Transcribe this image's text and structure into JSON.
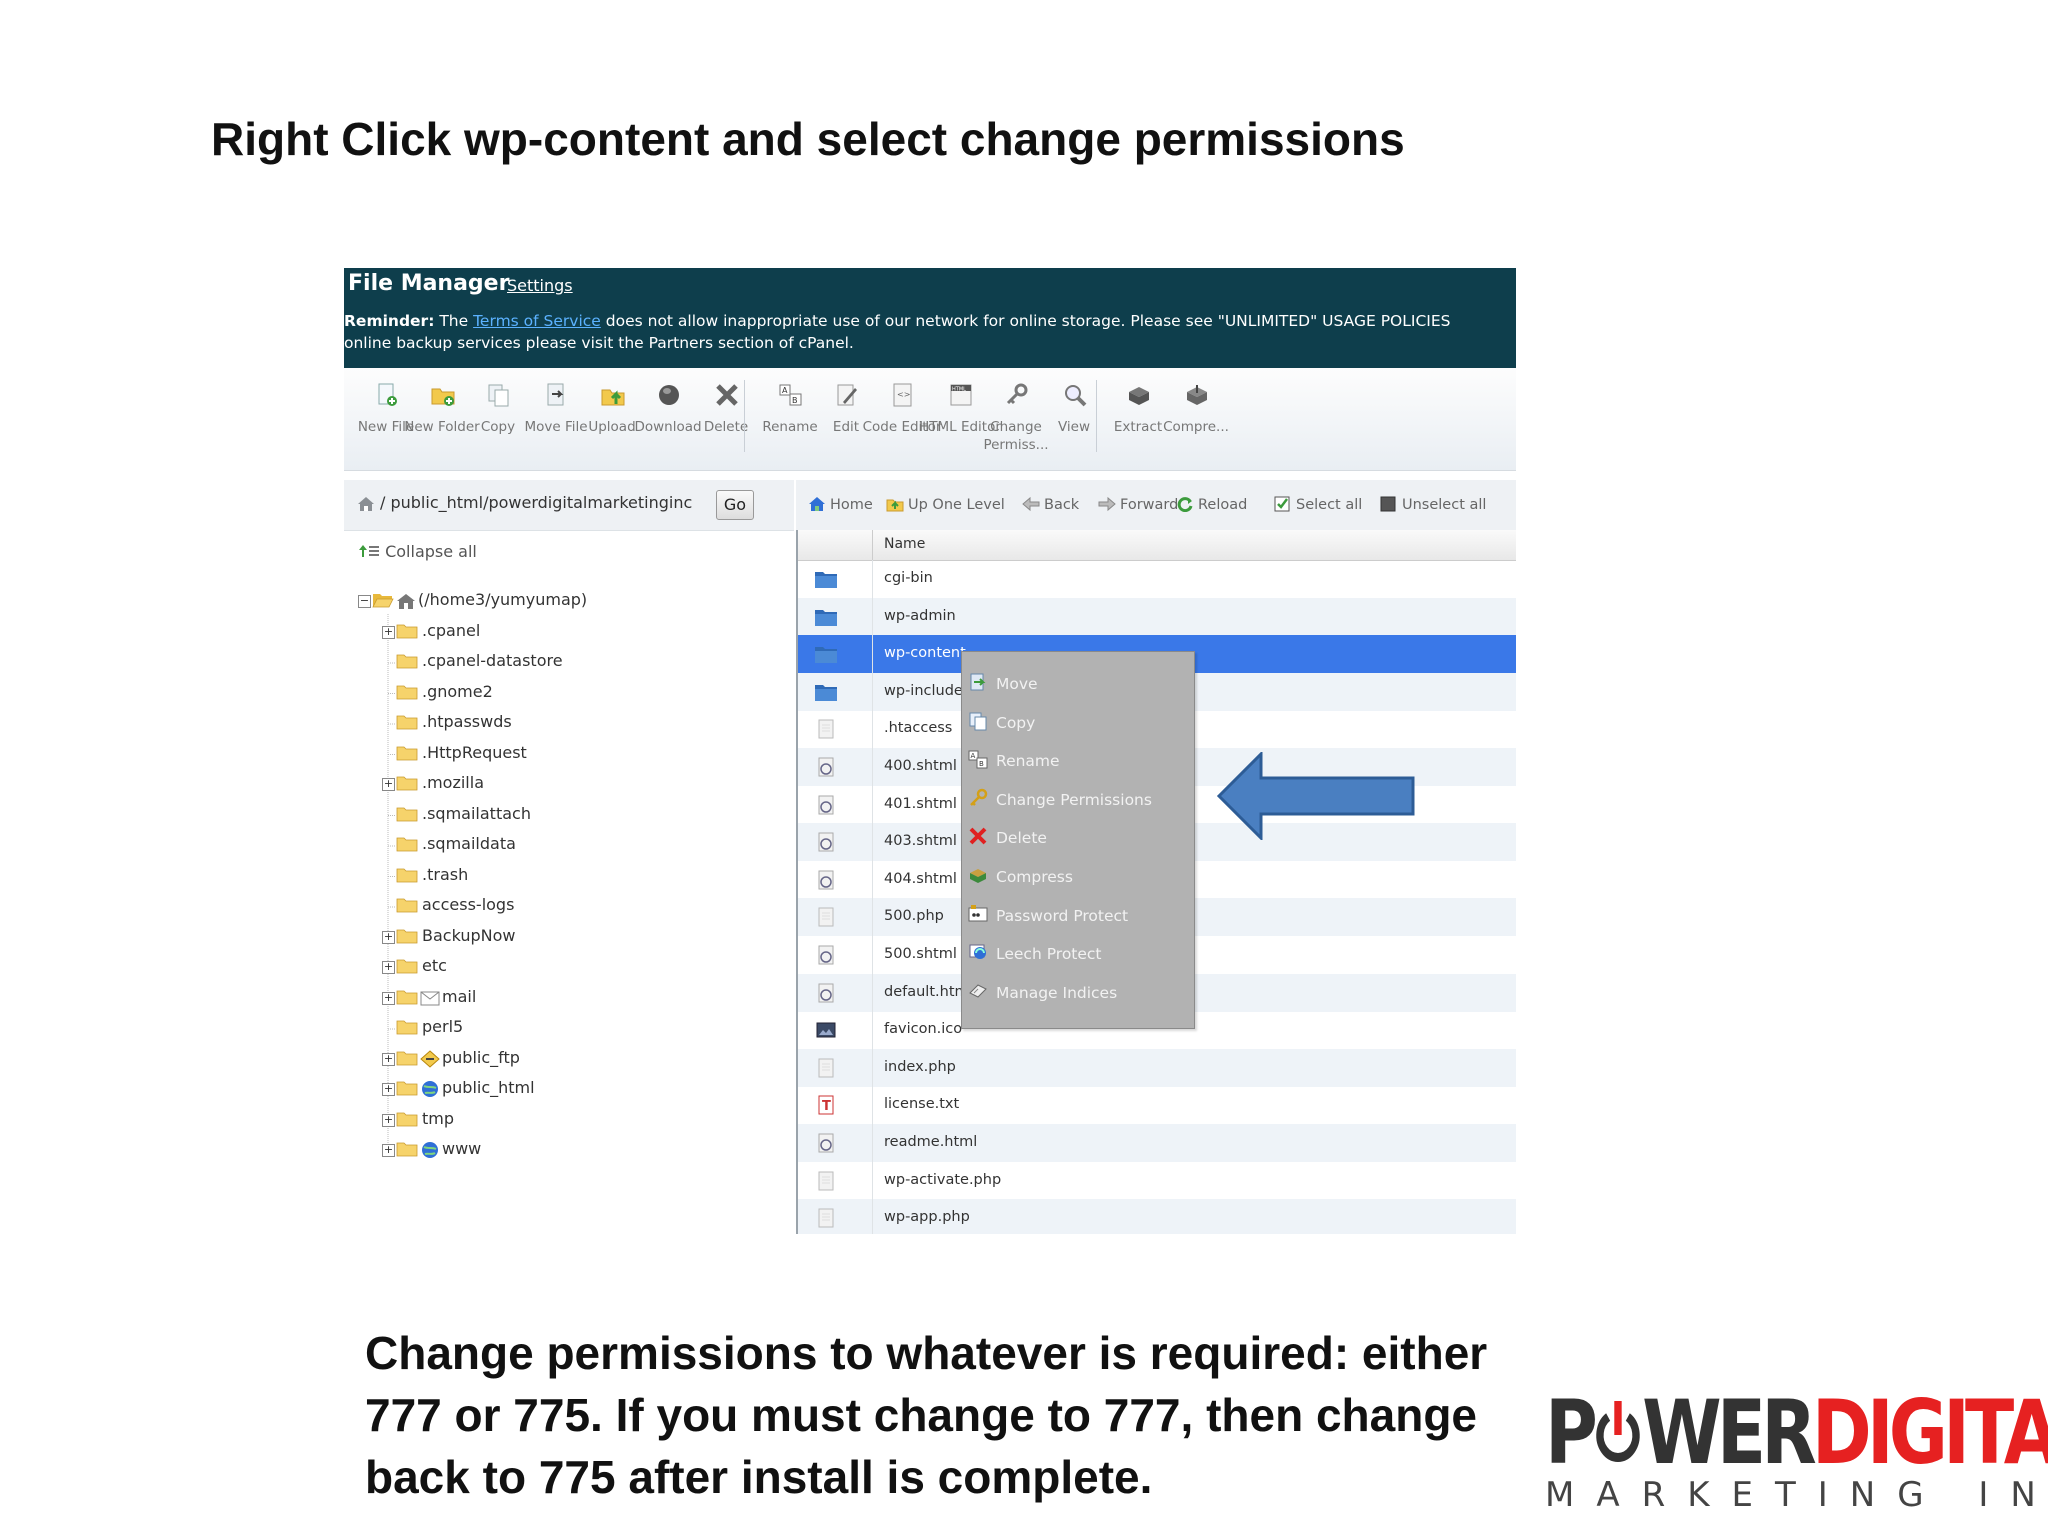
{
  "slide": {
    "title": "Right Click wp-content and select change permissions",
    "instruction_lines": [
      "Change permissions to whatever is required: either",
      "777 or 775. If you must change to 777, then change",
      "back to 775 after install is complete."
    ]
  },
  "file_manager": {
    "title": "File Manager",
    "settings_label": "Settings",
    "reminder_prefix": "Reminder:",
    "reminder_the": " The ",
    "reminder_link": "Terms of Service",
    "reminder_rest": " does not allow inappropriate use of our network for online storage. Please see \"UNLIMITED\" USAGE POLICIES",
    "reminder_line2": "online backup services please visit the Partners section of cPanel.",
    "toolbar": [
      {
        "label": "New File",
        "icon": "new-file-icon"
      },
      {
        "label": "New Folder",
        "icon": "new-folder-icon"
      },
      {
        "label": "Copy",
        "icon": "copy-icon"
      },
      {
        "label": "Move File",
        "icon": "move-file-icon"
      },
      {
        "label": "Upload",
        "icon": "upload-icon"
      },
      {
        "label": "Download",
        "icon": "download-icon"
      },
      {
        "label": "Delete",
        "icon": "delete-icon"
      },
      {
        "label": "Rename",
        "icon": "rename-icon"
      },
      {
        "label": "Edit",
        "icon": "edit-icon"
      },
      {
        "label": "Code Editor",
        "icon": "code-editor-icon"
      },
      {
        "label": "HTML Editor",
        "icon": "html-editor-icon"
      },
      {
        "label": "Change Permiss...",
        "icon": "change-permissions-icon"
      },
      {
        "label": "View",
        "icon": "view-icon"
      },
      {
        "label": "Extract",
        "icon": "extract-icon"
      },
      {
        "label": "Compre...",
        "icon": "compress-icon"
      }
    ],
    "path": "/ public_html/powerdigitalmarketinginc",
    "go_label": "Go",
    "collapse_label": "Collapse all",
    "tree": [
      {
        "label": "(/home3/yumyumap)",
        "expander": "−"
      },
      {
        "label": ".cpanel",
        "expander": "+"
      },
      {
        "label": ".cpanel-datastore",
        "expander": ""
      },
      {
        "label": ".gnome2",
        "expander": ""
      },
      {
        "label": ".htpasswds",
        "expander": ""
      },
      {
        "label": ".HttpRequest",
        "expander": ""
      },
      {
        "label": ".mozilla",
        "expander": "+"
      },
      {
        "label": ".sqmailattach",
        "expander": ""
      },
      {
        "label": ".sqmaildata",
        "expander": ""
      },
      {
        "label": ".trash",
        "expander": ""
      },
      {
        "label": "access-logs",
        "expander": ""
      },
      {
        "label": "BackupNow",
        "expander": "+"
      },
      {
        "label": "etc",
        "expander": "+"
      },
      {
        "label": "mail",
        "expander": "+"
      },
      {
        "label": "perl5",
        "expander": ""
      },
      {
        "label": "public_ftp",
        "expander": "+"
      },
      {
        "label": "public_html",
        "expander": "+"
      },
      {
        "label": "tmp",
        "expander": "+"
      },
      {
        "label": "www",
        "expander": "+"
      }
    ],
    "nav": [
      {
        "label": "Home",
        "icon": "home-icon"
      },
      {
        "label": "Up One Level",
        "icon": "up-level-icon"
      },
      {
        "label": "Back",
        "icon": "back-arrow-icon"
      },
      {
        "label": "Forward",
        "icon": "forward-arrow-icon"
      },
      {
        "label": "Reload",
        "icon": "reload-icon"
      },
      {
        "label": "Select all",
        "icon": "checkbox-checked-icon"
      },
      {
        "label": "Unselect all",
        "icon": "checkbox-empty-icon"
      }
    ],
    "list_header": "Name",
    "files": [
      {
        "name": "cgi-bin",
        "type": "folder"
      },
      {
        "name": "wp-admin",
        "type": "folder"
      },
      {
        "name": "wp-content",
        "type": "folder",
        "selected": true
      },
      {
        "name": "wp-include",
        "type": "folder"
      },
      {
        "name": ".htaccess",
        "type": "file"
      },
      {
        "name": "400.shtml",
        "type": "web"
      },
      {
        "name": "401.shtml",
        "type": "web"
      },
      {
        "name": "403.shtml",
        "type": "web"
      },
      {
        "name": "404.shtml",
        "type": "web"
      },
      {
        "name": "500.php",
        "type": "file"
      },
      {
        "name": "500.shtml",
        "type": "web"
      },
      {
        "name": "default.htm",
        "type": "web"
      },
      {
        "name": "favicon.ico",
        "type": "image"
      },
      {
        "name": "index.php",
        "type": "file"
      },
      {
        "name": "license.txt",
        "type": "text"
      },
      {
        "name": "readme.html",
        "type": "web"
      },
      {
        "name": "wp-activate.php",
        "type": "file"
      },
      {
        "name": "wp-app.php",
        "type": "file"
      }
    ],
    "context_menu": [
      {
        "label": "Move",
        "icon": "move-icon"
      },
      {
        "label": "Copy",
        "icon": "copy-icon"
      },
      {
        "label": "Rename",
        "icon": "rename-icon"
      },
      {
        "label": "Change Permissions",
        "icon": "key-icon"
      },
      {
        "label": "Delete",
        "icon": "delete-icon"
      },
      {
        "label": "Compress",
        "icon": "compress-icon"
      },
      {
        "label": "Password Protect",
        "icon": "password-icon"
      },
      {
        "label": "Leech Protect",
        "icon": "leech-protect-icon"
      },
      {
        "label": "Manage Indices",
        "icon": "manage-indices-icon"
      }
    ]
  },
  "logo": {
    "p": "P",
    "wer": "WER",
    "digital": "DIGITAL",
    "sub": "MARKETING INC."
  },
  "colors": {
    "header_bg": "#0e3e4c",
    "selected_row": "#3a78e8",
    "arrow": "#4a7fc1",
    "logo_red": "#e62121"
  }
}
